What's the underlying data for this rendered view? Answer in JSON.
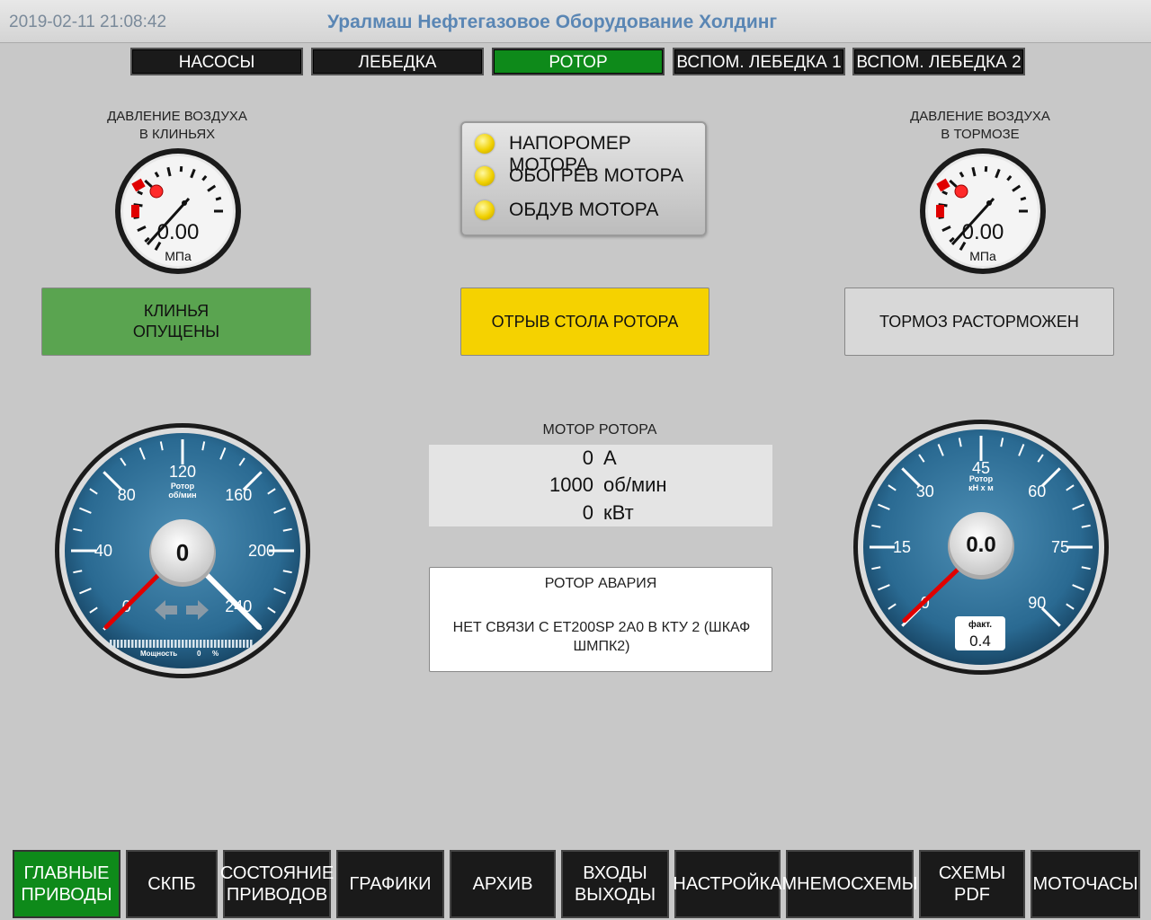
{
  "header": {
    "datetime": "2019-02-11 21:08:42",
    "company": "Уралмаш Нефтегазовое Оборудование Холдинг"
  },
  "tabs": [
    {
      "label": "НАСОСЫ"
    },
    {
      "label": "ЛЕБЕДКА"
    },
    {
      "label": "РОТОР",
      "active": true
    },
    {
      "label": "ВСПОМ. ЛЕБЕДКА 1"
    },
    {
      "label": "ВСПОМ. ЛЕБЕДКА 2"
    }
  ],
  "pressure_wedges": {
    "label_line1": "ДАВЛЕНИЕ ВОЗДУХА",
    "label_line2": "В КЛИНЬЯХ",
    "value": "0.00",
    "unit": "МПа"
  },
  "pressure_brake": {
    "label_line1": "ДАВЛЕНИЕ ВОЗДУХА",
    "label_line2": "В ТОРМОЗЕ",
    "value": "0.00",
    "unit": "МПа"
  },
  "indicators": [
    {
      "label": "НАПОРОМЕР МОТОРА",
      "color": "#f0d000"
    },
    {
      "label": "ОБОГРЕВ МОТОРА",
      "color": "#f0d000"
    },
    {
      "label": "ОБДУВ МОТОРА",
      "color": "#f0d000"
    }
  ],
  "status": {
    "wedges_line1": "КЛИНЬЯ",
    "wedges_line2": "ОПУЩЕНЫ",
    "wedges_color": "#5aa450",
    "table": "ОТРЫВ СТОЛА РОТОРА",
    "table_color": "#f5d200",
    "brake": "ТОРМОЗ РАСТОРМОЖЕН",
    "brake_color": "#d8d8d8"
  },
  "rpm_gauge": {
    "title_line1": "Ротор",
    "title_line2": "об/мин",
    "value": "0",
    "ticks": [
      "0",
      "40",
      "80",
      "120",
      "160",
      "200",
      "240"
    ],
    "power_label": "Мощность",
    "power_value": "0",
    "power_unit": "%",
    "needle_value": 0,
    "setpoint_value": 240,
    "min": 0,
    "max": 240
  },
  "torque_gauge": {
    "title_line1": "Ротор",
    "title_line2": "кН х м",
    "value": "0.0",
    "ticks": [
      "0",
      "15",
      "30",
      "45",
      "60",
      "75",
      "90"
    ],
    "actual_label": "факт.",
    "actual_value": "0.4",
    "needle_value": 0.4,
    "min": 0,
    "max": 90
  },
  "motor": {
    "title": "МОТОР РОТОРА",
    "rows": [
      {
        "value": "0",
        "unit": "А"
      },
      {
        "value": "1000",
        "unit": "об/мин"
      },
      {
        "value": "0",
        "unit": "кВт"
      }
    ]
  },
  "alarm": {
    "title": "РОТОР АВАРИЯ",
    "message": "НЕТ СВЯЗИ С ET200SP 2A0 В КТУ 2 (ШКАФ ШМПК2)"
  },
  "nav": [
    {
      "line1": "ГЛАВНЫЕ",
      "line2": "ПРИВОДЫ",
      "active": true
    },
    {
      "line1": "СКПБ",
      "line2": ""
    },
    {
      "line1": "СОСТОЯНИЕ",
      "line2": "ПРИВОДОВ"
    },
    {
      "line1": "ГРАФИКИ",
      "line2": ""
    },
    {
      "line1": "АРХИВ",
      "line2": ""
    },
    {
      "line1": "ВХОДЫ",
      "line2": "ВЫХОДЫ"
    },
    {
      "line1": "НАСТРОЙКА",
      "line2": ""
    },
    {
      "line1": "МНЕМОСХЕМЫ",
      "line2": ""
    },
    {
      "line1": "СХЕМЫ",
      "line2": "PDF"
    },
    {
      "line1": "МОТОЧАСЫ",
      "line2": ""
    }
  ]
}
